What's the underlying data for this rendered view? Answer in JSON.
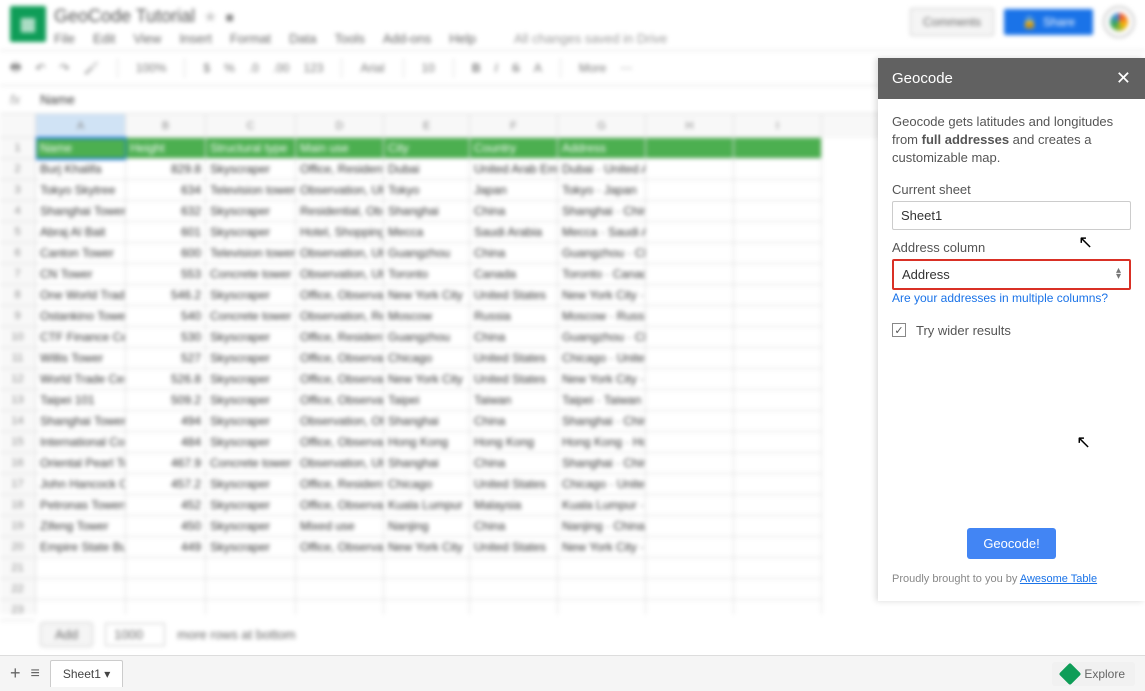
{
  "doc": {
    "title": "GeoCode Tutorial",
    "save_status": "All changes saved in Drive"
  },
  "menus": [
    "File",
    "Edit",
    "View",
    "Insert",
    "Format",
    "Data",
    "Tools",
    "Add-ons",
    "Help"
  ],
  "header_buttons": {
    "comments": "Comments",
    "share": "Share"
  },
  "toolbar": {
    "zoom": "100%",
    "currency": "$",
    "percent": "%",
    "dec_dec": ".0",
    "dec_inc": ".00",
    "format": "123",
    "font": "Arial",
    "size": "10",
    "more": "More"
  },
  "formula_bar": {
    "fx": "fx",
    "value": "Name"
  },
  "columns": [
    "A",
    "B",
    "C",
    "D",
    "E",
    "F",
    "G",
    "H",
    "I"
  ],
  "headers": [
    "Name",
    "Height",
    "Structural type",
    "Main use",
    "City",
    "Country",
    "Address"
  ],
  "rows": [
    [
      "Burj Khalifa",
      "829.8",
      "Skyscraper",
      "Office, Residential",
      "Dubai",
      "United Arab Emirates",
      "Dubai · United Arab Emirates"
    ],
    [
      "Tokyo Skytree",
      "634",
      "Television tower",
      "Observation, UHF",
      "Tokyo",
      "Japan",
      "Tokyo · Japan"
    ],
    [
      "Shanghai Tower",
      "632",
      "Skyscraper",
      "Residential, Observation",
      "Shanghai",
      "China",
      "Shanghai · China"
    ],
    [
      "Abraj Al Bait",
      "601",
      "Skyscraper",
      "Hotel, Shopping",
      "Mecca",
      "Saudi Arabia",
      "Mecca · Saudi Arabia"
    ],
    [
      "Canton Tower",
      "600",
      "Television tower",
      "Observation, UHF",
      "Guangzhou",
      "China",
      "Guangzhou · China"
    ],
    [
      "CN Tower",
      "553",
      "Concrete tower",
      "Observation, UHF",
      "Toronto",
      "Canada",
      "Toronto · Canada"
    ],
    [
      "One World Trade Center",
      "546.2",
      "Skyscraper",
      "Office, Observation",
      "New York City",
      "United States",
      "New York City · United States"
    ],
    [
      "Ostankino Tower",
      "540",
      "Concrete tower",
      "Observation, Restaurant",
      "Moscow",
      "Russia",
      "Moscow · Russia"
    ],
    [
      "CTF Finance Centre",
      "530",
      "Skyscraper",
      "Office, Residential",
      "Guangzhou",
      "China",
      "Guangzhou · China"
    ],
    [
      "Willis Tower",
      "527",
      "Skyscraper",
      "Office, Observation",
      "Chicago",
      "United States",
      "Chicago · United States"
    ],
    [
      "World Trade Center",
      "526.8",
      "Skyscraper",
      "Office, Observation",
      "New York City",
      "United States",
      "New York City · United States"
    ],
    [
      "Taipei 101",
      "509.2",
      "Skyscraper",
      "Office, Observation",
      "Taipei",
      "Taiwan",
      "Taipei · Taiwan"
    ],
    [
      "Shanghai Tower",
      "494",
      "Skyscraper",
      "Observation, Office",
      "Shanghai",
      "China",
      "Shanghai · China"
    ],
    [
      "International Commerce Centre",
      "484",
      "Skyscraper",
      "Office, Observation",
      "Hong Kong",
      "Hong Kong",
      "Hong Kong · Hong Kong"
    ],
    [
      "Oriental Pearl Tower",
      "467.9",
      "Concrete tower",
      "Observation, UHF",
      "Shanghai",
      "China",
      "Shanghai · China"
    ],
    [
      "John Hancock Center",
      "457.2",
      "Skyscraper",
      "Office, Residential",
      "Chicago",
      "United States",
      "Chicago · United States"
    ],
    [
      "Petronas Towers",
      "452",
      "Skyscraper",
      "Office, Observation",
      "Kuala Lumpur",
      "Malaysia",
      "Kuala Lumpur · Malaysia"
    ],
    [
      "Zifeng Tower",
      "450",
      "Skyscraper",
      "Mixed use",
      "Nanjing",
      "China",
      "Nanjing · China"
    ],
    [
      "Empire State Building",
      "449",
      "Skyscraper",
      "Office, Observation",
      "New York City",
      "United States",
      "New York City · United States"
    ]
  ],
  "bottom": {
    "add": "Add",
    "count": "1000",
    "more_text": "more rows at bottom"
  },
  "tabs": {
    "sheet1": "Sheet1",
    "explore": "Explore"
  },
  "panel": {
    "title": "Geocode",
    "desc_prefix": "Geocode gets latitudes and longitudes from ",
    "desc_bold": "full addresses",
    "desc_suffix": " and creates a customizable map.",
    "current_sheet_label": "Current sheet",
    "current_sheet_value": "Sheet1",
    "address_label": "Address column",
    "address_value": "Address",
    "multi_link": "Are your addresses in multiple columns?",
    "wider": "Try wider results",
    "geocode_btn": "Geocode!",
    "credit_prefix": "Proudly brought to you by ",
    "credit_link": "Awesome Table"
  }
}
